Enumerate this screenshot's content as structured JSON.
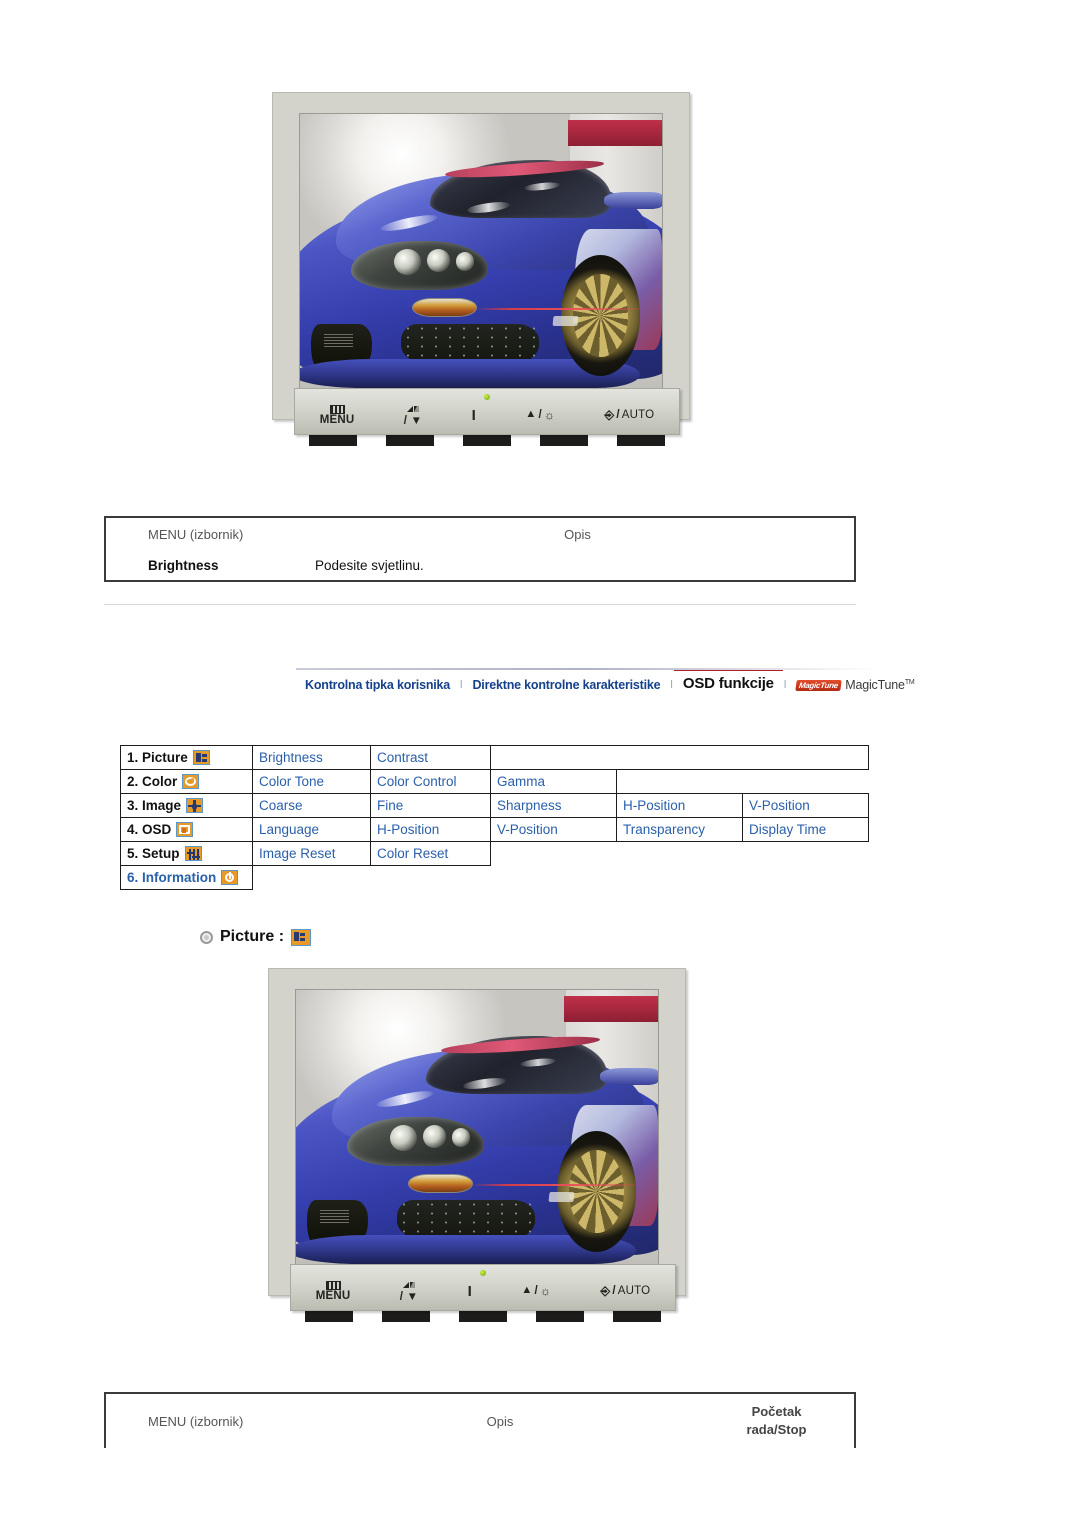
{
  "monitor_top": {
    "name": "samsung-lcd-monitor-brightness",
    "panel_buttons": [
      {
        "icon": "menu-grid-icon",
        "label": "MENU"
      },
      {
        "icon": "source-icon",
        "label": "/ ▼"
      },
      {
        "icon": "power-icon",
        "label": ""
      },
      {
        "icon": "brightness-icon",
        "label": "▲ /"
      },
      {
        "icon": "enter-auto-icon",
        "label": "/ AUTO"
      }
    ],
    "power_led": "green"
  },
  "desc_table_top": {
    "header": {
      "menu": "MENU (izbornik)",
      "description": "Opis"
    },
    "rows": [
      {
        "menu": "Brightness",
        "description": "Podesite svjetlinu."
      }
    ]
  },
  "navbar": {
    "tabs": [
      {
        "label": "Kontrolna tipka korisnika",
        "active": false
      },
      {
        "label": "Direktne kontrolne karakteristike",
        "active": false
      },
      {
        "label": "OSD funkcije",
        "active": true
      },
      {
        "label": "MagicTune",
        "active": false,
        "logo": "magictune-logo",
        "trademark": "TM"
      }
    ],
    "divider": "l",
    "active_accent": "#b01c24",
    "link_color": "#16418c"
  },
  "osd_menu": {
    "rows": [
      {
        "category": "1. Picture",
        "icon": "picture-icon",
        "items": [
          "Brightness",
          "Contrast"
        ]
      },
      {
        "category": "2. Color",
        "icon": "color-icon",
        "items": [
          "Color Tone",
          "Color Control",
          "Gamma"
        ]
      },
      {
        "category": "3. Image",
        "icon": "image-icon",
        "items": [
          "Coarse",
          "Fine",
          "Sharpness",
          "H-Position",
          "V-Position"
        ]
      },
      {
        "category": "4. OSD",
        "icon": "osd-icon",
        "items": [
          "Language",
          "H-Position",
          "V-Position",
          "Transparency",
          "Display Time"
        ]
      },
      {
        "category": "5. Setup",
        "icon": "setup-icon",
        "items": [
          "Image Reset",
          "Color Reset"
        ]
      },
      {
        "category": "6. Information",
        "icon": "information-icon",
        "items": [],
        "highlighted": true
      }
    ],
    "link_color": "#2a5faa"
  },
  "section_picture": {
    "title": "Picture :",
    "bullet": "bullet-icon",
    "icon": "picture-icon"
  },
  "monitor_bottom": {
    "name": "samsung-lcd-monitor-picture",
    "panel_buttons": [
      {
        "icon": "menu-grid-icon",
        "label": "MENU"
      },
      {
        "icon": "source-icon",
        "label": "/ ▼"
      },
      {
        "icon": "power-icon",
        "label": ""
      },
      {
        "icon": "brightness-icon",
        "label": "▲ /"
      },
      {
        "icon": "enter-auto-icon",
        "label": "/ AUTO"
      }
    ],
    "power_led": "green"
  },
  "desc_table_bottom": {
    "header": {
      "menu": "MENU (izbornik)",
      "description": "Opis",
      "playstop": "Početak\nrada/Stop"
    },
    "playstop_line1": "Početak",
    "playstop_line2": "rada/Stop"
  }
}
